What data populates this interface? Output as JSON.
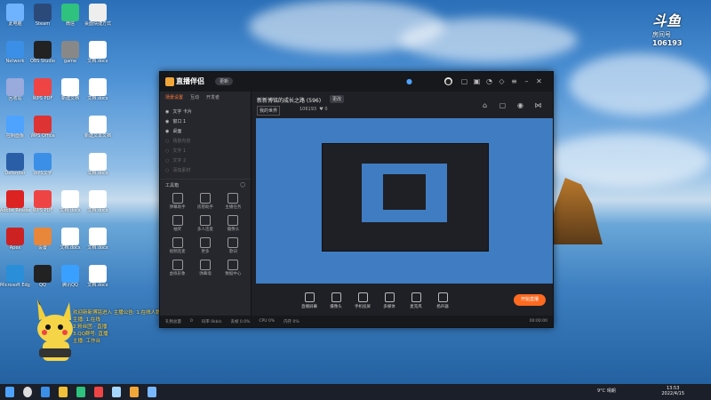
{
  "desktop": {
    "icons": [
      {
        "label": "此电脑"
      },
      {
        "label": "Steam"
      },
      {
        "label": "微信"
      },
      {
        "label": "桌面快捷方式"
      },
      {
        "label": "Network"
      },
      {
        "label": "OBS Studio"
      },
      {
        "label": "game"
      },
      {
        "label": "文档.docx"
      },
      {
        "label": "回收站"
      },
      {
        "label": "WPS PDF"
      },
      {
        "label": "新建文档"
      },
      {
        "label": "文档.docx"
      },
      {
        "label": "控制面板"
      },
      {
        "label": "WPS Office"
      },
      {
        "label": "新建文本文档"
      },
      {
        "label": "Defender"
      },
      {
        "label": "WPS文字"
      },
      {
        "label": "文档.docx"
      },
      {
        "label": "Adobe Reader XI"
      },
      {
        "label": "WPS PDF"
      },
      {
        "label": "文档.docx"
      },
      {
        "label": "文档.docx"
      },
      {
        "label": "Apex"
      },
      {
        "label": "设置"
      },
      {
        "label": "文档.docx"
      },
      {
        "label": "文档.docx"
      },
      {
        "label": "Microsoft Edge"
      },
      {
        "label": "QQ"
      },
      {
        "label": "腾讯QQ"
      },
      {
        "label": "文档.docx"
      }
    ]
  },
  "app": {
    "name": "直播伴侣",
    "version": "更新",
    "side_tabs": [
      "场景设置",
      "互动",
      "开发者"
    ],
    "scenes": [
      {
        "label": "文字 卡片",
        "visible": true
      },
      {
        "label": "窗口 1",
        "visible": true
      },
      {
        "label": "桌面",
        "visible": true
      },
      {
        "label": "场景内容",
        "visible": false
      },
      {
        "label": "文字 1",
        "visible": false
      },
      {
        "label": "文字 2",
        "visible": false
      },
      {
        "label": "添加素材",
        "visible": false
      }
    ],
    "tools_title": "工具箱",
    "tools": [
      {
        "label": "弹幕助手"
      },
      {
        "label": "房管助手"
      },
      {
        "label": "主播任务"
      },
      {
        "label": "抽奖"
      },
      {
        "label": "多人连麦"
      },
      {
        "label": "摄像头"
      },
      {
        "label": "视频连麦"
      },
      {
        "label": "更多"
      },
      {
        "label": "歌词"
      },
      {
        "label": "虚拟形象"
      },
      {
        "label": "弹幕墙"
      },
      {
        "label": "数据中心"
      }
    ],
    "room": {
      "title": "新新博铭的成长之路 (596)",
      "badge": "更改",
      "category": "我的世界",
      "room_number": "106193",
      "likes": "0"
    },
    "controls": [
      {
        "label": "直播屏幕"
      },
      {
        "label": "摄像头"
      },
      {
        "label": "手机投屏"
      },
      {
        "label": "多媒体"
      },
      {
        "label": "麦克风"
      },
      {
        "label": "扬声器"
      }
    ],
    "go_live": "开始直播",
    "status": [
      "礼物总量",
      "0",
      "码率 0kb/s",
      "丢帧 0.0%",
      "CPU 0%",
      "内存 0%"
    ],
    "duration": "00:00:00"
  },
  "overlay_lines": [
    "欢迎新新博铭进入 主播公告: 1.在线人数 +",
    "主播: 1.在线",
    "2.粉丝团 - 直播",
    "3.QQ群号: 直播",
    "主播: 工作台"
  ],
  "douyu": {
    "logo": "斗鱼",
    "room_label": "房间号",
    "room_id": "106193"
  },
  "taskbar": {
    "weather": "9°C 晴朗",
    "time": "13:53",
    "date": "2022/4/15"
  },
  "colors": {
    "accent": "#ff6a21",
    "app_bg": "#1f2025"
  }
}
